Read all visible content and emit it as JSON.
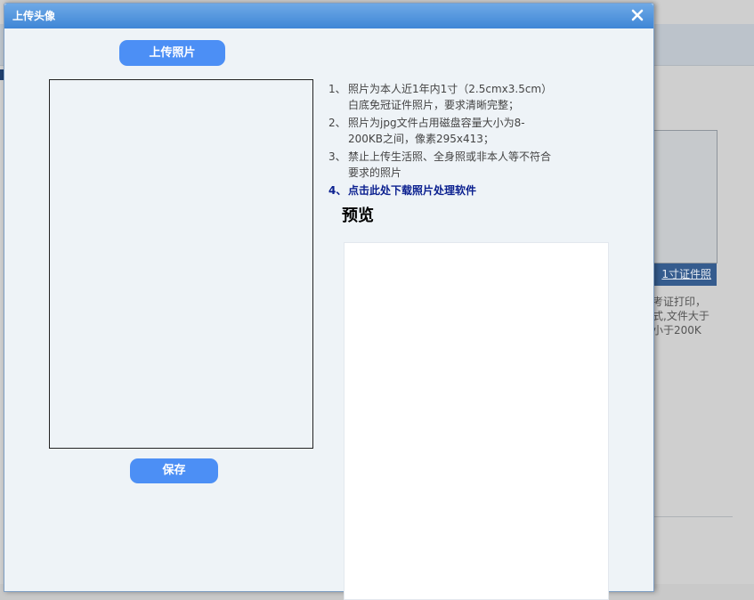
{
  "background": {
    "photo_tab": "1寸证件照",
    "notes": [
      "考证打印，",
      "式,文件大于",
      "小于200K"
    ]
  },
  "dialog": {
    "title": "上传头像",
    "upload_button": "上传照片",
    "save_button": "保存",
    "instructions": [
      {
        "num": "1、",
        "lines": [
          "照片为本人近1年内1寸（2.5cmx3.5cm）",
          "白底免冠证件照片，要求清晰完整；"
        ]
      },
      {
        "num": "2、",
        "lines": [
          "照片为jpg文件占用磁盘容量大小为8-",
          "200KB之间，像素295x413；"
        ]
      },
      {
        "num": "3、",
        "lines": [
          "禁止上传生活照、全身照或非本人等不符合",
          "要求的照片"
        ]
      }
    ],
    "download_item": {
      "num": "4、",
      "text": "点击此处下载照片处理软件"
    },
    "preview_title": "预览"
  },
  "colors": {
    "titlebar": "#4f93dd",
    "button": "#4c8ff5",
    "dialog_bg": "#eef3f7",
    "link": "#0a1f8f"
  }
}
